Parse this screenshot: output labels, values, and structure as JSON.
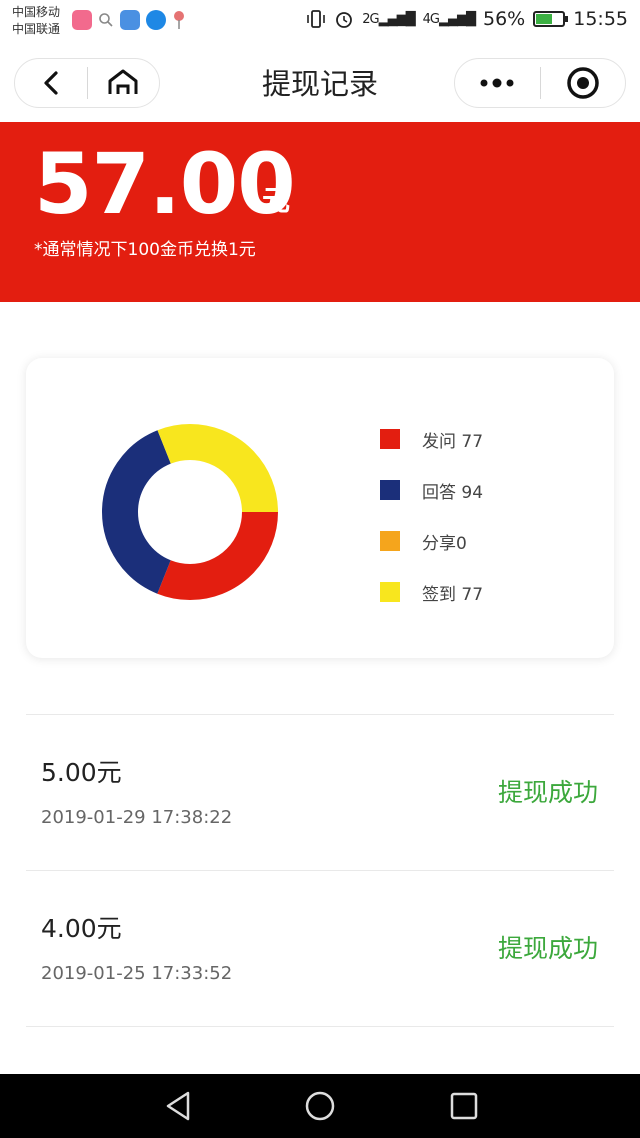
{
  "status_bar": {
    "carrier_1": "中国移动",
    "carrier_2": "中国联通",
    "network_2g": "2G",
    "network_4g": "4G",
    "battery": "56%",
    "time": "15:55",
    "battery_level": 0.56
  },
  "nav": {
    "title": "提现记录"
  },
  "summary": {
    "amount": "57.00",
    "unit": "元",
    "note": "*通常情况下100金币兑换1元"
  },
  "chart_data": {
    "type": "pie",
    "categories": [
      "发问",
      "回答",
      "分享",
      "签到"
    ],
    "values": [
      77,
      94,
      0,
      77
    ],
    "colors": [
      "#e31e10",
      "#1b2f7a",
      "#f5a51c",
      "#f8e61e"
    ],
    "legend_labels": [
      "发问 77",
      "回答 94",
      "分享0",
      "签到 77"
    ],
    "legend": "right"
  },
  "records": [
    {
      "amount": "5.00元",
      "date": "2019-01-29 17:38:22",
      "status": "提现成功"
    },
    {
      "amount": "4.00元",
      "date": "2019-01-25 17:33:52",
      "status": "提现成功"
    }
  ],
  "colors": {
    "header_red": "#e31e10",
    "success_green": "#3ca83c"
  }
}
